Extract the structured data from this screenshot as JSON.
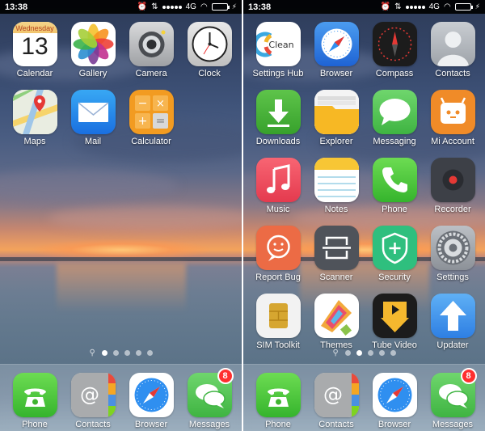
{
  "status": {
    "time": "13:38",
    "network": "4G",
    "battery_level": 0.85,
    "signal_bars": 5
  },
  "left_screen": {
    "apps": [
      {
        "label": "Calendar",
        "day_name": "Wednesday",
        "day_number": "13",
        "icon": "calendar-icon"
      },
      {
        "label": "Gallery",
        "icon": "gallery-icon"
      },
      {
        "label": "Camera",
        "icon": "camera-icon"
      },
      {
        "label": "Clock",
        "icon": "clock-icon"
      },
      {
        "label": "Maps",
        "icon": "maps-icon"
      },
      {
        "label": "Mail",
        "icon": "mail-icon"
      },
      {
        "label": "Calculator",
        "icon": "calculator-icon"
      }
    ],
    "page_count": 5,
    "active_page": 0
  },
  "right_screen": {
    "apps": [
      {
        "label": "Settings Hub",
        "icon_text": "Clean",
        "icon": "settings-hub-icon"
      },
      {
        "label": "Browser",
        "icon": "browser-icon"
      },
      {
        "label": "Compass",
        "icon": "compass-icon"
      },
      {
        "label": "Contacts",
        "icon": "contacts-icon"
      },
      {
        "label": "Downloads",
        "icon": "downloads-icon"
      },
      {
        "label": "Explorer",
        "icon": "explorer-icon"
      },
      {
        "label": "Messaging",
        "icon": "messaging-icon"
      },
      {
        "label": "Mi Account",
        "icon": "mi-account-icon"
      },
      {
        "label": "Music",
        "icon": "music-icon"
      },
      {
        "label": "Notes",
        "icon": "notes-icon"
      },
      {
        "label": "Phone",
        "icon": "phone-icon"
      },
      {
        "label": "Recorder",
        "icon": "recorder-icon"
      },
      {
        "label": "Report Bug",
        "icon": "report-bug-icon"
      },
      {
        "label": "Scanner",
        "icon": "scanner-icon"
      },
      {
        "label": "Security",
        "icon": "security-icon"
      },
      {
        "label": "Settings",
        "icon": "settings-icon"
      },
      {
        "label": "SIM Toolkit",
        "icon": "sim-toolkit-icon"
      },
      {
        "label": "Themes",
        "icon": "themes-icon"
      },
      {
        "label": "Tube Video",
        "icon": "tube-video-icon"
      },
      {
        "label": "Updater",
        "icon": "updater-icon"
      }
    ],
    "page_count": 5,
    "active_page": 1
  },
  "dock": {
    "apps": [
      {
        "label": "Phone",
        "icon": "phone-icon"
      },
      {
        "label": "Contacts",
        "icon": "contacts-book-icon"
      },
      {
        "label": "Browser",
        "icon": "browser-icon"
      },
      {
        "label": "Messages",
        "icon": "messages-icon",
        "badge": "8"
      }
    ]
  },
  "colors": {
    "badge": "#ff2f2f",
    "battery": "#6cdc3a",
    "statusbar": "#000000"
  }
}
